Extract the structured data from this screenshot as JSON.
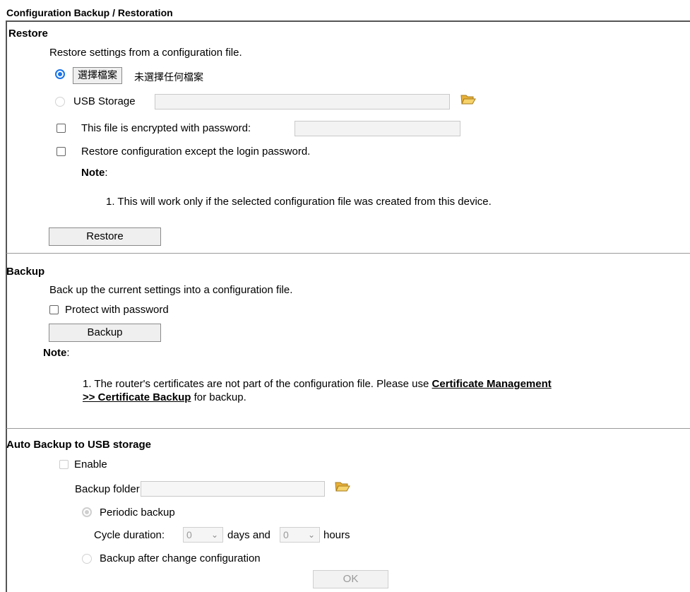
{
  "page": {
    "title": "Configuration Backup / Restoration"
  },
  "restore": {
    "heading": "Restore",
    "description": "Restore settings from a configuration file.",
    "file_button": "選擇檔案",
    "file_status": "未選擇任何檔案",
    "usb_label": "USB Storage",
    "usb_value": "",
    "encrypted_label": "This file is encrypted with password:",
    "encrypted_password": "",
    "except_login_label": "Restore configuration except the login password.",
    "note_label": "Note",
    "note_colon": ":",
    "note_item": "1. This will work only if the selected configuration file was created from this device.",
    "restore_button": "Restore"
  },
  "backup": {
    "heading": "Backup",
    "description": "Back up the current settings into a configuration file.",
    "protect_label": "Protect with password",
    "backup_button": "Backup",
    "note_label": "Note",
    "note_colon": ":",
    "note_prefix": "1. The router's certificates are not part of the configuration file. Please use ",
    "note_link_1": "Certificate Management",
    "note_link_2": ">> Certificate Backup",
    "note_suffix": " for backup."
  },
  "auto_backup": {
    "heading": "Auto Backup to USB storage",
    "enable_label": "Enable",
    "folder_label": "Backup folder",
    "folder_value": "",
    "periodic_label": "Periodic backup",
    "cycle_label": "Cycle duration:",
    "days_value": "0",
    "days_label": "days and",
    "hours_value": "0",
    "hours_label": "hours",
    "after_change_label": "Backup after change configuration",
    "ok_button": "OK"
  },
  "icons": {
    "folder": "folder-open-icon",
    "chevron": "chevron-down-icon",
    "folder_color": "#f2c04a"
  }
}
